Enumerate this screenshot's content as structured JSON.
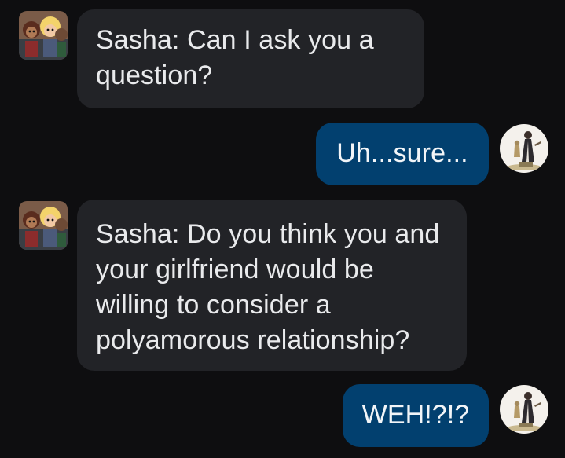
{
  "messages": [
    {
      "sender": "incoming",
      "text": "Sasha: Can I ask you a question?"
    },
    {
      "sender": "outgoing",
      "text": "Uh...sure..."
    },
    {
      "sender": "incoming",
      "text": "Sasha: Do you think you and your girlfriend would be willing to consider a polyamorous relationship?"
    },
    {
      "sender": "outgoing",
      "text": "WEH!?!?"
    }
  ],
  "colors": {
    "background": "#0e0e10",
    "incoming_bubble": "#222327",
    "outgoing_bubble": "#02406f",
    "text": "#e9eaec"
  },
  "icons": {
    "incoming_avatar": "cartoon-group-avatar-icon",
    "outgoing_avatar": "figurine-avatar-icon"
  }
}
